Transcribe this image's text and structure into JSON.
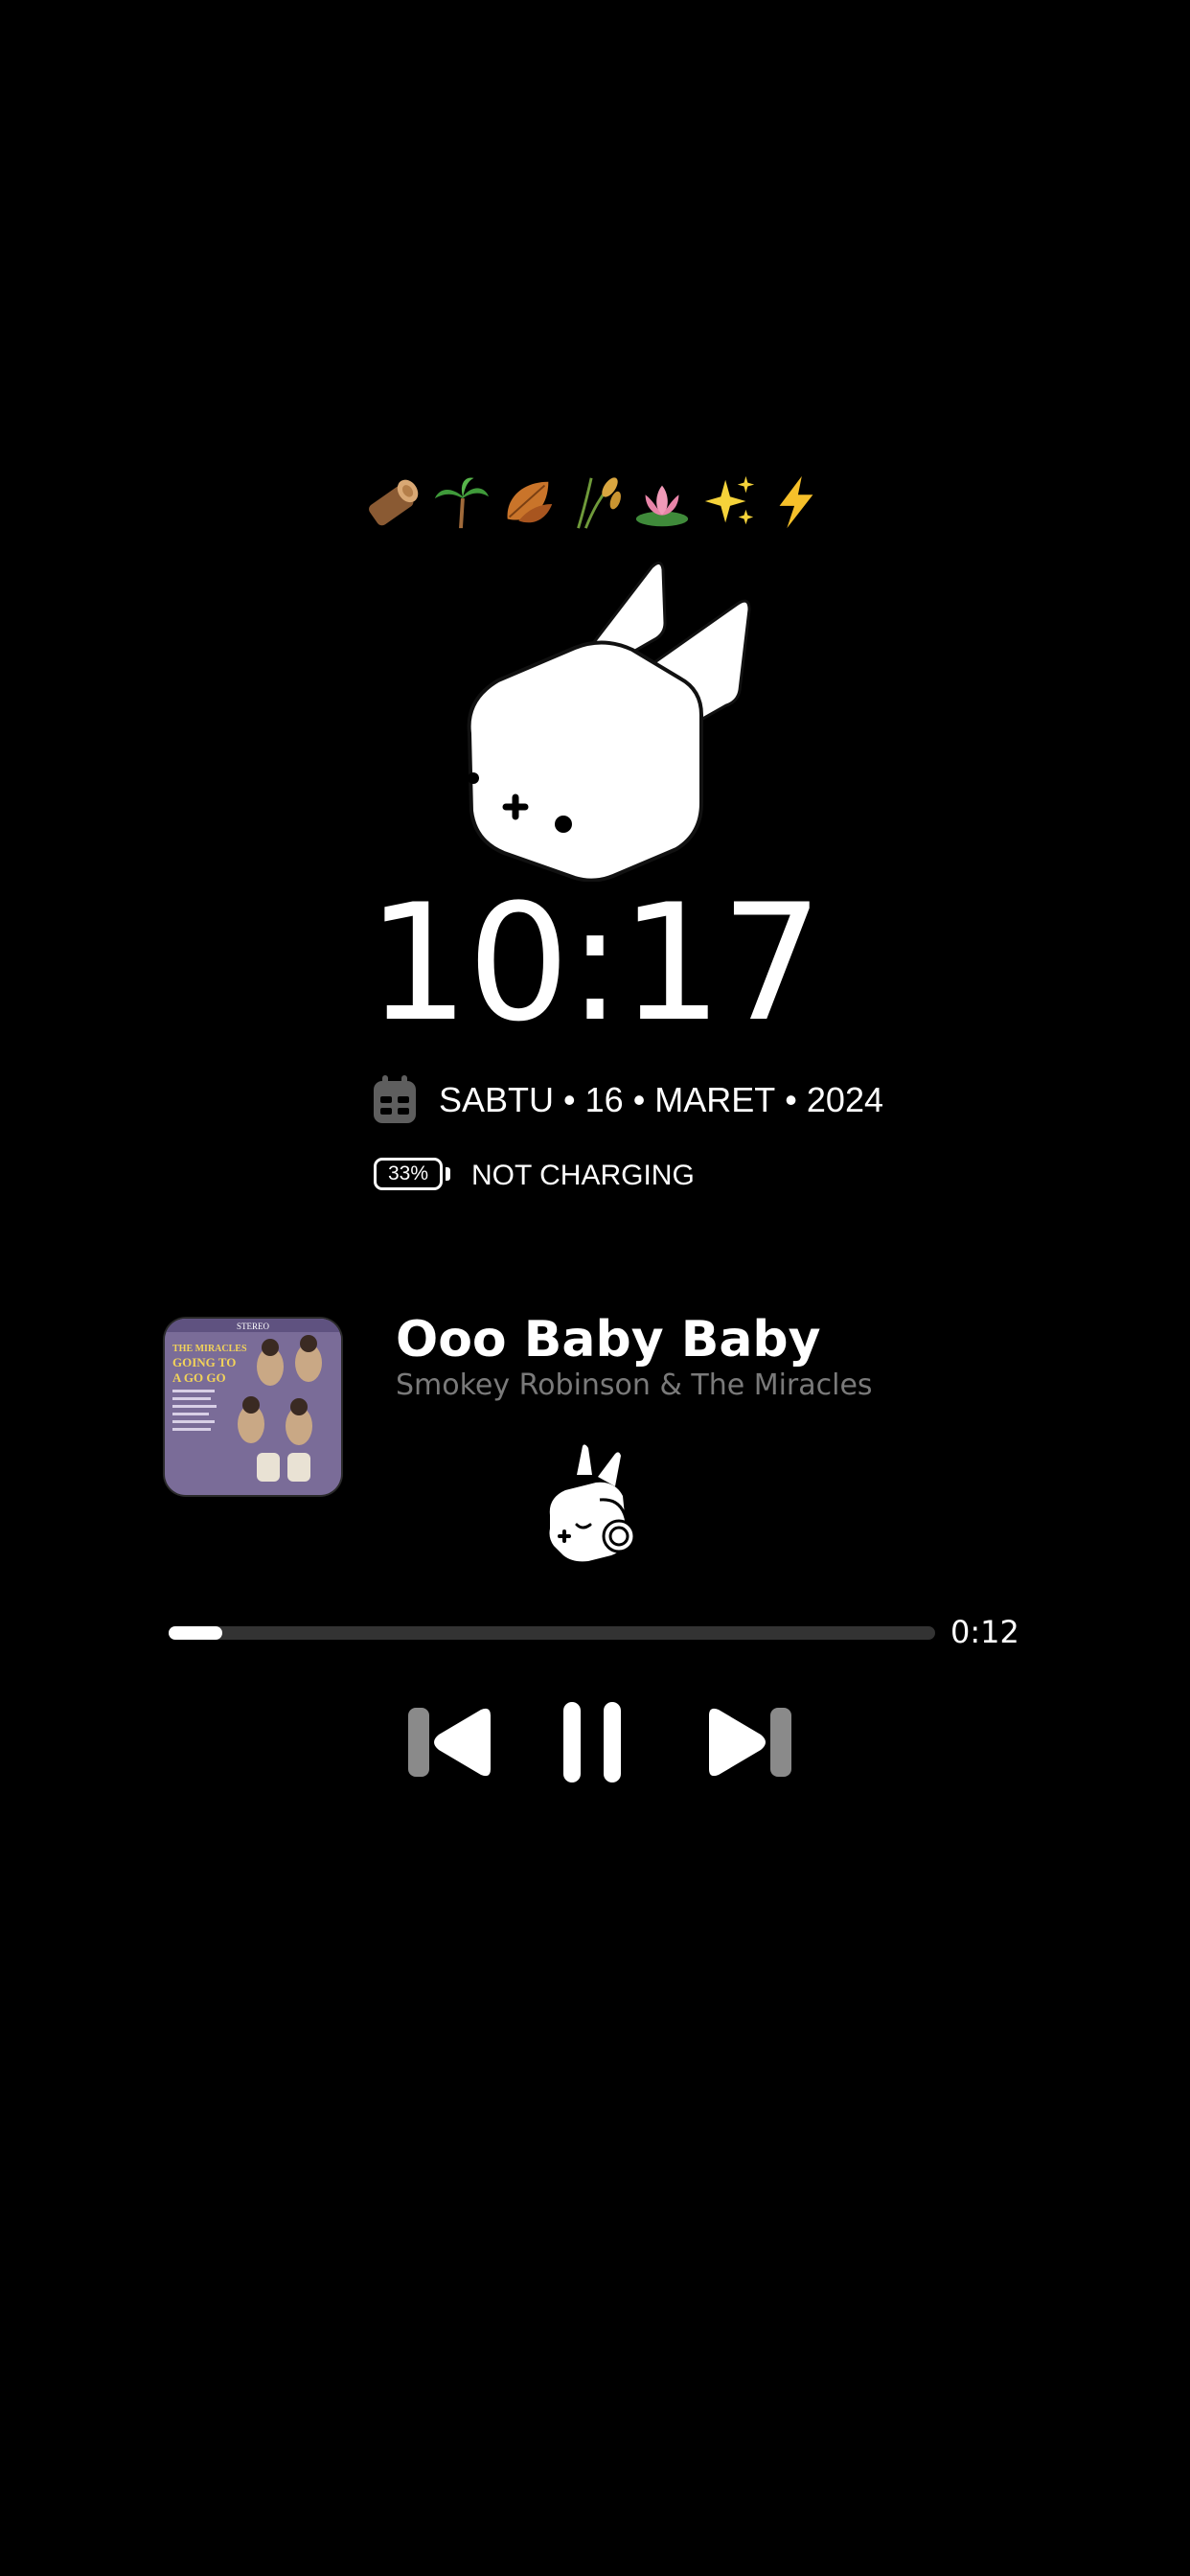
{
  "emoji_row": {
    "icons": [
      "wood-log-icon",
      "palm-tree-icon",
      "fallen-leaf-icon",
      "rice-sheaf-icon",
      "lotus-icon",
      "sparkles-icon",
      "lightning-icon"
    ]
  },
  "lockscreen": {
    "time": "10:17",
    "date": {
      "day": "SABTU",
      "date": "16",
      "month": "MARET",
      "year": "2024",
      "separator": "•"
    },
    "battery": {
      "percent_label": "33%",
      "level": 0.33,
      "status": "NOT CHARGING"
    }
  },
  "now_playing": {
    "title": "Ooo Baby Baby",
    "artist": "Smokey Robinson & The Miracles",
    "elapsed": "0:12",
    "progress": 0.07,
    "album_art": {
      "header": "STEREO",
      "artist_line": "THE MIRACLES",
      "title_line_1": "GOING TO",
      "title_line_2": "A GO GO"
    }
  },
  "colors": {
    "background": "#000000",
    "foreground": "#ffffff",
    "muted": "#7a7a7a",
    "track": "#333333",
    "control_dim": "#8a8a8a"
  }
}
